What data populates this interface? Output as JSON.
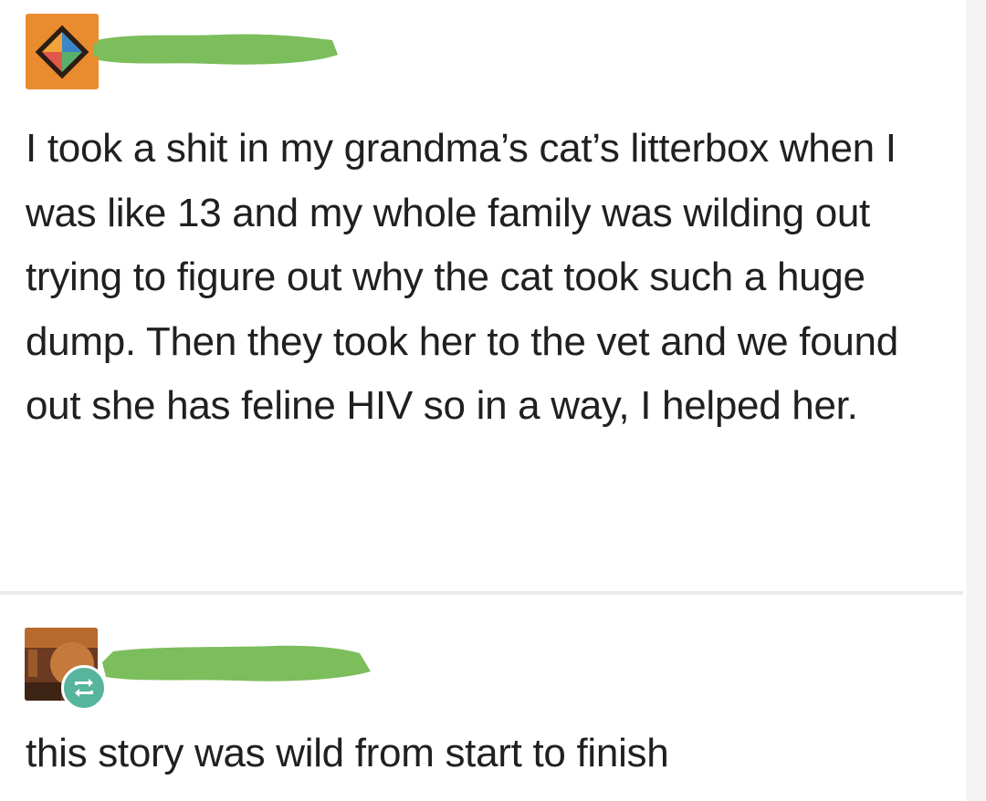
{
  "posts": [
    {
      "avatar_icon": "diamond-logo-icon",
      "avatar_color": "#e98c2f",
      "username_redacted": true,
      "redaction_color": "#7cbd5c",
      "text": "I took a shit in my grandma’s cat’s litterbox when I was like 13 and my whole family was wilding out trying to figure out why the cat took such a huge dump. Then they took her to the vet and we found out she has feline HIV so in a way, I helped her."
    },
    {
      "avatar_icon": "profile-picture",
      "badge_icon": "reblog-icon",
      "badge_color": "#56b59c",
      "username_redacted": true,
      "redaction_color": "#7cbd5c",
      "text": "this story was wild from start to finish"
    }
  ]
}
